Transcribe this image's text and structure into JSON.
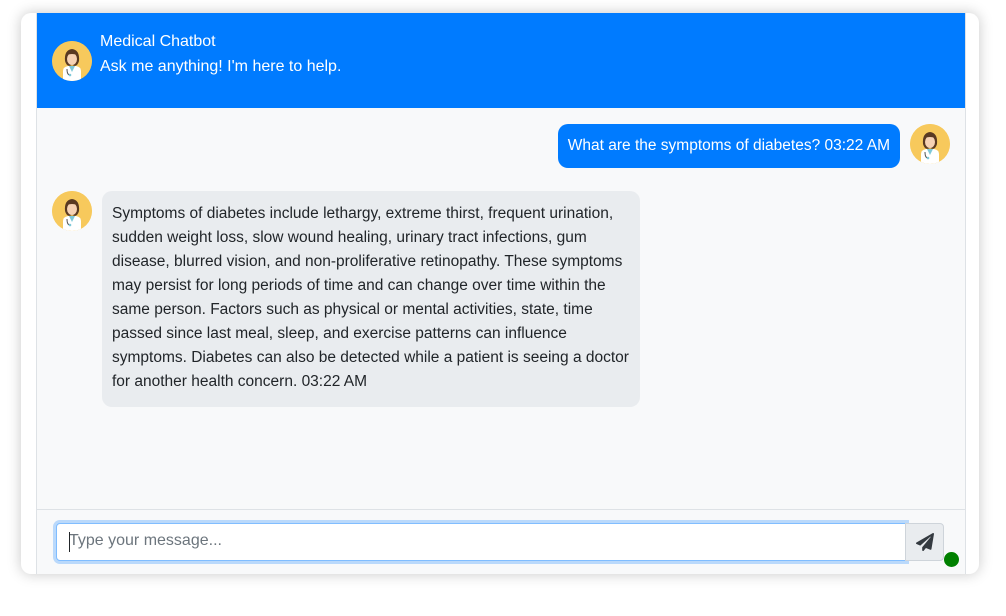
{
  "header": {
    "title": "Medical Chatbot",
    "subtitle": "Ask me anything! I'm here to help."
  },
  "messages": [
    {
      "role": "user",
      "text": "What are the symptoms of diabetes? 03:22 AM"
    },
    {
      "role": "bot",
      "text": "Symptoms of diabetes include lethargy, extreme thirst, frequent urination, sudden weight loss, slow wound healing, urinary tract infections, gum disease, blurred vision, and non-proliferative retinopathy. These symptoms may persist for long periods of time and can change over time within the same person. Factors such as physical or mental activities, state, time passed since last meal, sleep, and exercise patterns can influence symptoms. Diabetes can also be detected while a patient is seeing a doctor for another health concern. 03:22 AM"
    }
  ],
  "input": {
    "value": "",
    "placeholder": "Type your message..."
  },
  "icons": {
    "avatar": "doctor-avatar-icon",
    "send": "paper-plane-icon",
    "status": "online-status-dot"
  },
  "colors": {
    "primary": "#007bff",
    "bot_bubble": "#e9ecef",
    "background": "#f8f9fa",
    "avatar_bg": "#f7c95c",
    "status": "#008000"
  }
}
